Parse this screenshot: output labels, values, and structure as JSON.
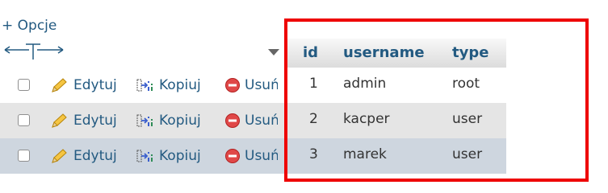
{
  "options_link": "+ Opcje",
  "columns": {
    "id": "id",
    "username": "username",
    "type": "type"
  },
  "actions": {
    "edit": "Edytuj",
    "copy": "Kopiuj",
    "delete": "Usuń"
  },
  "rows": [
    {
      "id": "1",
      "username": "admin",
      "type": "root"
    },
    {
      "id": "2",
      "username": "kacper",
      "type": "user"
    },
    {
      "id": "3",
      "username": "marek",
      "type": "user"
    }
  ],
  "colors": {
    "link": "#235a81",
    "highlight_border": "#ee0000",
    "row_alt": "#e5e5e5",
    "row_hover": "#ced6df"
  },
  "icons": [
    "column-arrows-icon",
    "sort-caret-icon",
    "pencil-icon",
    "copy-icon",
    "delete-icon"
  ]
}
